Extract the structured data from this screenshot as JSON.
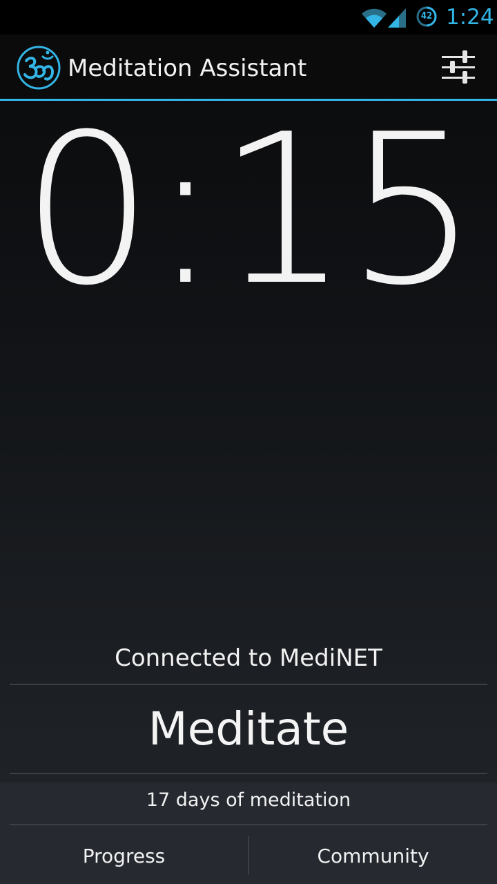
{
  "status_bar": {
    "battery_level": "42",
    "time": "1:24",
    "wifi_icon": "wifi-icon",
    "signal_icon": "cell-signal-icon",
    "accent_color": "#33b5e5"
  },
  "action_bar": {
    "logo_icon": "om-icon",
    "title": "Meditation Assistant",
    "settings_icon": "sliders-icon"
  },
  "timer": {
    "display": "0:15"
  },
  "status": {
    "connection": "Connected to MediNET"
  },
  "main": {
    "meditate_label": "Meditate",
    "streak": "17 days of meditation"
  },
  "bottom_nav": {
    "progress_label": "Progress",
    "community_label": "Community"
  },
  "colors": {
    "accent": "#33b5e5",
    "text": "#f2f2f2"
  }
}
